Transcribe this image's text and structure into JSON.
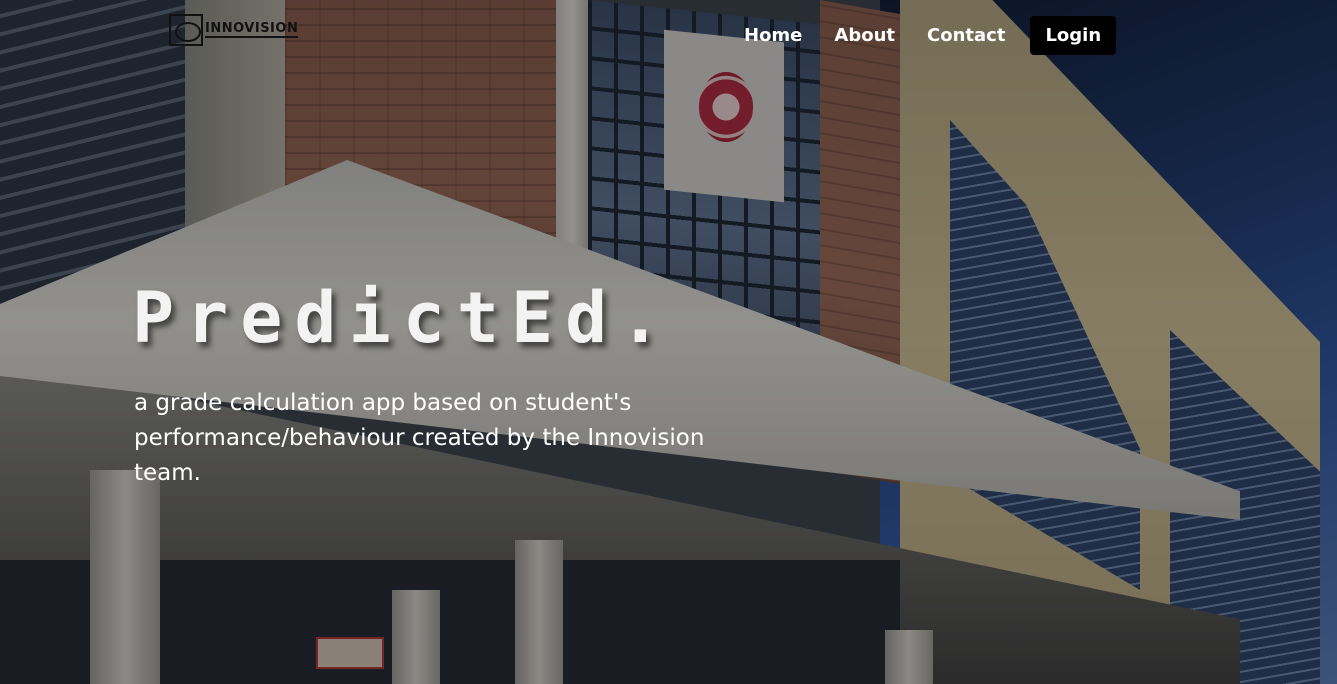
{
  "brand": {
    "logo_text": "INNOVISION"
  },
  "nav": {
    "items": [
      {
        "label": "Home"
      },
      {
        "label": "About"
      },
      {
        "label": "Contact"
      }
    ],
    "login_label": "Login"
  },
  "hero": {
    "title": "PredictEd.",
    "subtitle": "a grade calculation app based on student's performance/behaviour created by the Innovision team."
  },
  "colors": {
    "login_bg": "#000000",
    "text": "#ffffff"
  }
}
